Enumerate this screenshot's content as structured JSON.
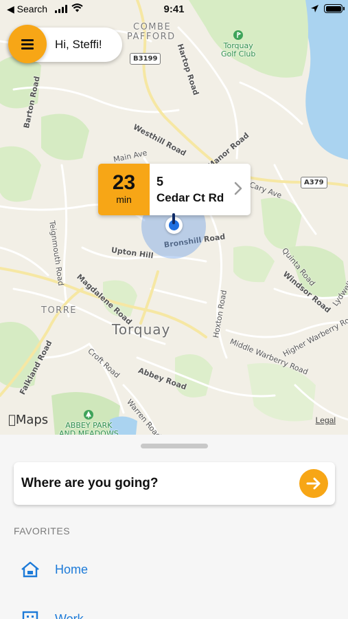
{
  "status_bar": {
    "back_label": "◀ Search",
    "time": "9:41"
  },
  "header": {
    "greeting": "Hi, Steffi!"
  },
  "eta_card": {
    "minutes": "23",
    "unit": "min",
    "house_number": "5",
    "street": "Cedar Ct Rd"
  },
  "map": {
    "town": "Torquay",
    "districts": [
      "COMBE",
      "PAFFORD",
      "TORRE"
    ],
    "poi": {
      "golf": [
        "Torquay",
        "Golf Club"
      ],
      "park": [
        "ABBEY PARK",
        "AND MEADOWS"
      ]
    },
    "roads": {
      "hartop": "Hartop Road",
      "barton": "Barton Road",
      "westhill": "Westhill Road",
      "manor": "Manor Road",
      "main_ave": "Main Ave",
      "cary_ave": "Cary Ave",
      "bronshill": "Bronshill Road",
      "upton_hill": "Upton Hill",
      "teignmouth": "Teignmouth Road",
      "magdalene": "Magdalene Road",
      "quinta": "Quinta Road",
      "windsor": "Windsor Road",
      "lydwell": "Lydwell",
      "hoxton": "Hoxton Road",
      "higher_warberry": "Higher Warberry Road",
      "middle_warberry": "Middle Warberry Road",
      "falkland": "Falkland Road",
      "croft": "Croft Road",
      "abbey": "Abbey Road",
      "warren": "Warren Road",
      "shield_b3199": "B3199",
      "shield_a379": "A379"
    },
    "attribution": "Maps",
    "legal": "Legal"
  },
  "sheet": {
    "search_placeholder": "Where are you going?",
    "favorites_header": "FAVORITES",
    "favorites": [
      {
        "label": "Home",
        "icon": "home-icon"
      },
      {
        "label": "Work",
        "icon": "building-icon"
      }
    ]
  },
  "colors": {
    "accent": "#f7a616",
    "link": "#1c7ad8",
    "location": "#1e6fe0"
  }
}
